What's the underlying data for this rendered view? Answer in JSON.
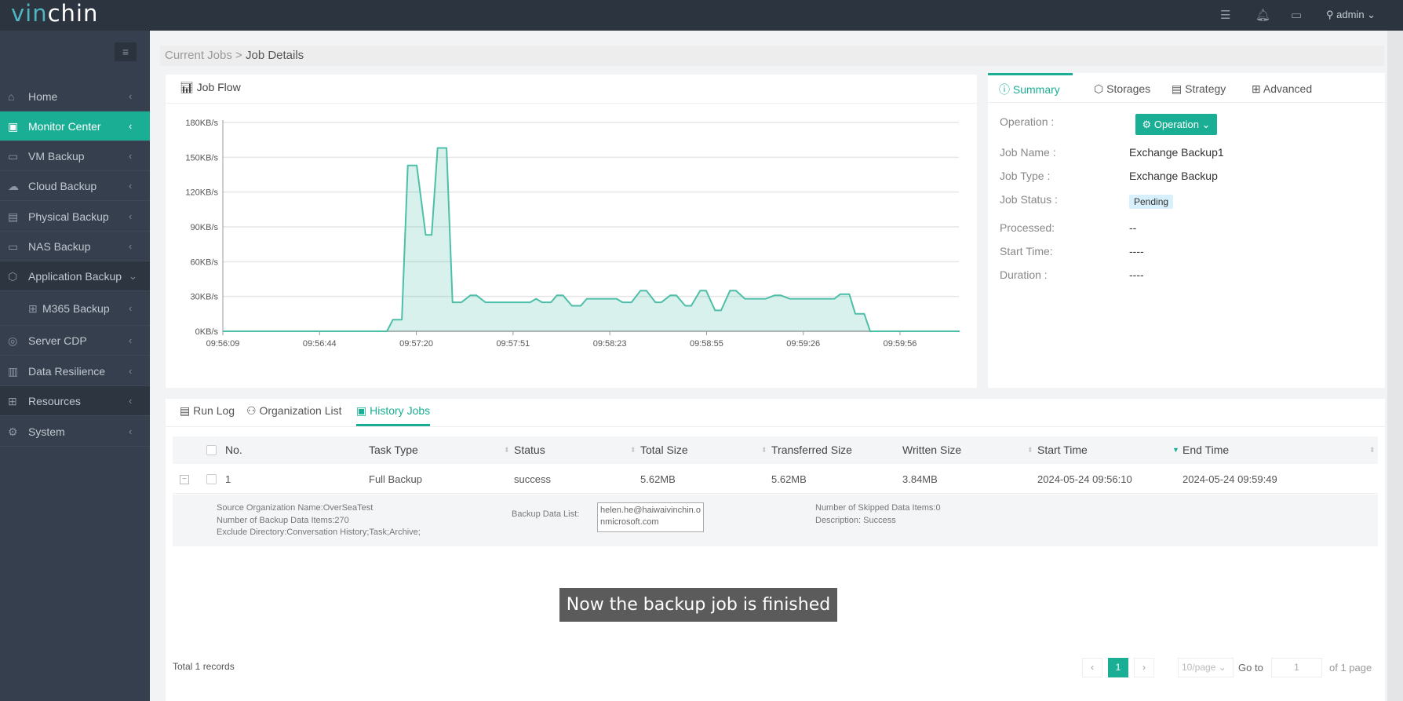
{
  "app": {
    "logo": "vinchin",
    "user": "admin",
    "icons": [
      "list-icon",
      "bell-icon",
      "monitor-icon",
      "user-icon"
    ]
  },
  "sidebar": {
    "items": [
      {
        "label": "Home",
        "icon": "home-icon"
      },
      {
        "label": "Monitor Center",
        "icon": "monitor-center-icon",
        "active": true
      },
      {
        "label": "VM Backup",
        "icon": "vm-icon"
      },
      {
        "label": "Cloud Backup",
        "icon": "cloud-icon"
      },
      {
        "label": "Physical Backup",
        "icon": "physical-icon"
      },
      {
        "label": "NAS Backup",
        "icon": "nas-icon"
      },
      {
        "label": "Application Backup",
        "icon": "application-icon",
        "expanded": true
      },
      {
        "label": "M365 Backup",
        "icon": "m365-icon"
      },
      {
        "label": "Server CDP",
        "icon": "cdp-icon"
      },
      {
        "label": "Data Resilience",
        "icon": "resilience-icon"
      },
      {
        "label": "Resources",
        "icon": "resources-icon"
      },
      {
        "label": "System",
        "icon": "gear-icon"
      }
    ]
  },
  "breadcrumb": {
    "parent": "Current Jobs",
    "sep": ">",
    "current": "Job Details"
  },
  "job_flow": {
    "title": "Job Flow"
  },
  "chart_data": {
    "type": "area",
    "ylabel": "",
    "xlabel": "",
    "ylim": [
      0,
      180
    ],
    "yticks": [
      "0KB/s",
      "30KB/s",
      "60KB/s",
      "90KB/s",
      "120KB/s",
      "150KB/s",
      "180KB/s"
    ],
    "xticks": [
      "09:56:09",
      "09:56:44",
      "09:57:20",
      "09:57:51",
      "09:58:23",
      "09:58:55",
      "09:59:26",
      "09:59:56"
    ],
    "xlim": [
      "09:56:09",
      "10:00:16"
    ],
    "grid": true,
    "color": "#4dbfa8",
    "points": [
      [
        "09:56:09",
        0
      ],
      [
        "09:57:04",
        0
      ],
      [
        "09:57:06",
        10
      ],
      [
        "09:57:09",
        10
      ],
      [
        "09:57:11",
        143
      ],
      [
        "09:57:14",
        143
      ],
      [
        "09:57:17",
        83
      ],
      [
        "09:57:19",
        83
      ],
      [
        "09:57:21",
        158
      ],
      [
        "09:57:24",
        158
      ],
      [
        "09:57:26",
        25
      ],
      [
        "09:57:29",
        25
      ],
      [
        "09:57:32",
        31
      ],
      [
        "09:57:34",
        31
      ],
      [
        "09:57:37",
        25
      ],
      [
        "09:57:52",
        25
      ],
      [
        "09:57:54",
        28
      ],
      [
        "09:57:56",
        25
      ],
      [
        "09:57:59",
        25
      ],
      [
        "09:58:01",
        31
      ],
      [
        "09:58:03",
        31
      ],
      [
        "09:58:06",
        22
      ],
      [
        "09:58:09",
        22
      ],
      [
        "09:58:11",
        28
      ],
      [
        "09:58:21",
        28
      ],
      [
        "09:58:23",
        25
      ],
      [
        "09:58:26",
        25
      ],
      [
        "09:58:29",
        35
      ],
      [
        "09:58:31",
        35
      ],
      [
        "09:58:34",
        25
      ],
      [
        "09:58:36",
        25
      ],
      [
        "09:58:39",
        31
      ],
      [
        "09:58:41",
        31
      ],
      [
        "09:58:44",
        22
      ],
      [
        "09:58:46",
        22
      ],
      [
        "09:58:49",
        35
      ],
      [
        "09:58:51",
        35
      ],
      [
        "09:58:54",
        18
      ],
      [
        "09:58:56",
        18
      ],
      [
        "09:58:59",
        35
      ],
      [
        "09:59:01",
        35
      ],
      [
        "09:59:04",
        28
      ],
      [
        "09:59:11",
        28
      ],
      [
        "09:59:14",
        31
      ],
      [
        "09:59:16",
        31
      ],
      [
        "09:59:19",
        28
      ],
      [
        "09:59:34",
        28
      ],
      [
        "09:59:36",
        32
      ],
      [
        "09:59:39",
        32
      ],
      [
        "09:59:41",
        15
      ],
      [
        "09:59:44",
        15
      ],
      [
        "09:59:46",
        0
      ],
      [
        "10:00:16",
        0
      ]
    ]
  },
  "summary": {
    "tabs": [
      {
        "label": "Summary",
        "icon": "info-icon"
      },
      {
        "label": "Storages",
        "icon": "cube-icon"
      },
      {
        "label": "Strategy",
        "icon": "strategy-icon"
      },
      {
        "label": "Advanced",
        "icon": "grid-icon"
      }
    ],
    "operation_label": "Operation :",
    "operation_button": "Operation",
    "rows": [
      {
        "k": "Job Name :",
        "v": "Exchange Backup1"
      },
      {
        "k": "Job Type :",
        "v": "Exchange Backup"
      },
      {
        "k": "Job Status :",
        "v": "Pending"
      },
      {
        "k": "Processed:",
        "v": "--"
      },
      {
        "k": "Start Time:",
        "v": "----"
      },
      {
        "k": "Duration :",
        "v": "----"
      }
    ]
  },
  "bottom": {
    "tabs": [
      {
        "label": "Run Log",
        "icon": "log-icon"
      },
      {
        "label": "Organization List",
        "icon": "org-icon"
      },
      {
        "label": "History Jobs",
        "icon": "history-icon",
        "active": true
      }
    ],
    "columns": [
      "No.",
      "Task Type",
      "Status",
      "Total Size",
      "Transferred Size",
      "Written Size",
      "Start Time",
      "End Time"
    ],
    "rows": [
      {
        "no": "1",
        "task_type": "Full Backup",
        "status": "success",
        "total": "5.62MB",
        "transferred": "5.62MB",
        "written": "3.84MB",
        "start": "2024-05-24 09:56:10",
        "end": "2024-05-24 09:59:49"
      }
    ],
    "detail": {
      "source": "Source Organization Name:OverSeaTest",
      "items": "Number of Backup Data Items:270",
      "exclude": "Exclude Directory:Conversation History;Task;Archive;",
      "list_label": "Backup Data List:",
      "list_value": "helen.he@haiwaivinchin.onmicrosoft.com",
      "skipped": "Number of Skipped Data Items:0",
      "description": "Description:  Success"
    },
    "total": "Total 1 records",
    "pagination": {
      "prev": "‹",
      "page": "1",
      "next": "›",
      "per_page": "10/page",
      "goto": "Go to",
      "goto_value": "1",
      "of": "of 1 page"
    }
  },
  "caption": "Now the backup job is finished"
}
